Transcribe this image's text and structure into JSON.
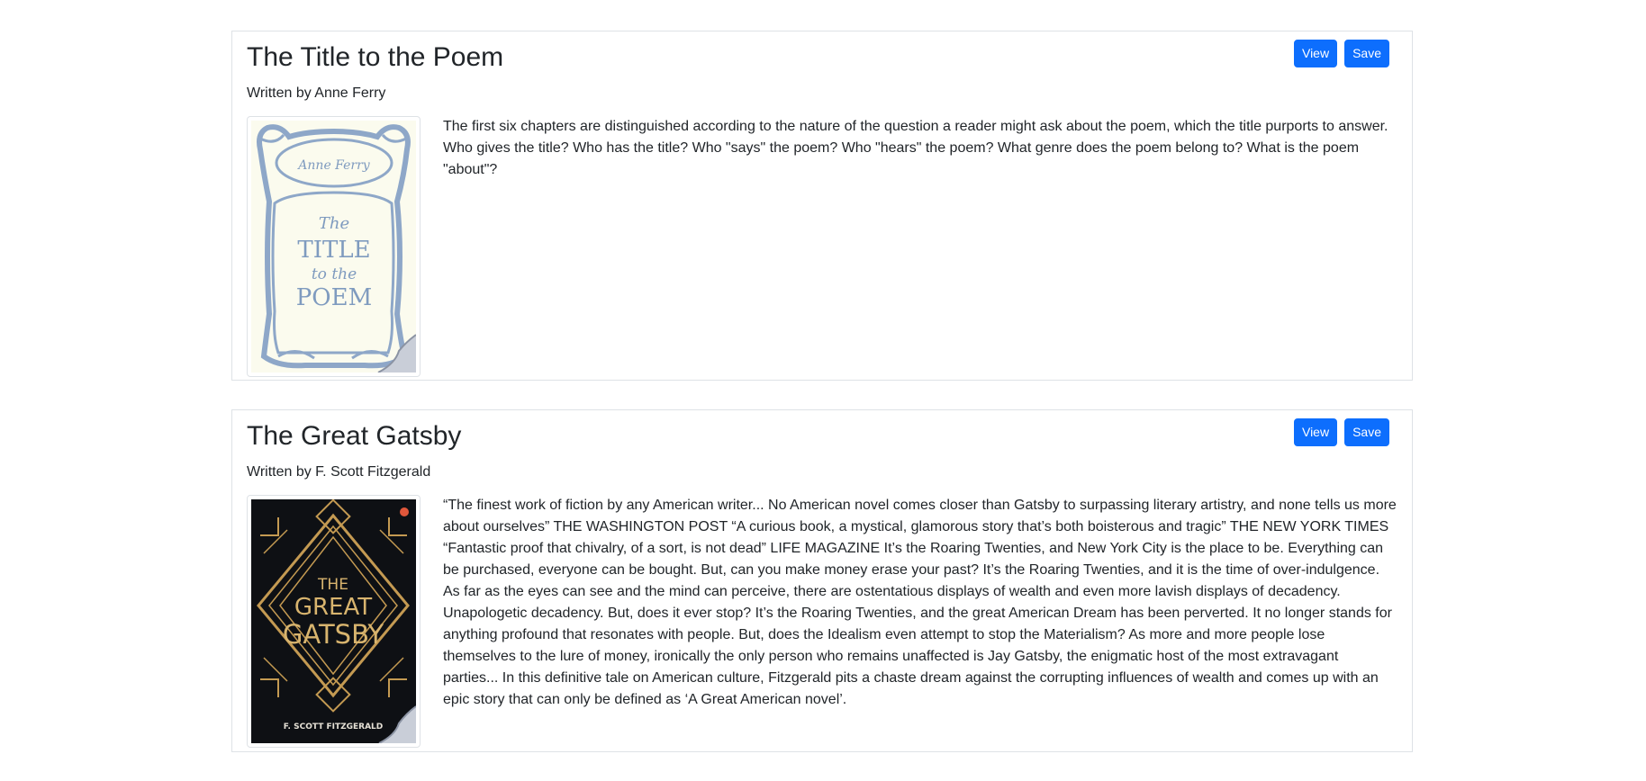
{
  "books": [
    {
      "title": "The Title to the Poem",
      "author_line": "Written by Anne Ferry",
      "view_label": "View",
      "save_label": "Save",
      "cover": {
        "author": "Anne Ferry",
        "line1": "The",
        "line2": "TITLE",
        "line3": "to the",
        "line4": "POEM"
      },
      "description": "The first six chapters are distinguished according to the nature of the question a reader might ask about the poem, which the title purports to answer. Who gives the title? Who has the title? Who \"says\" the poem? Who \"hears\" the poem? What genre does the poem belong to? What is the poem \"about\"?"
    },
    {
      "title": "The Great Gatsby",
      "author_line": "Written by F. Scott Fitzgerald",
      "view_label": "View",
      "save_label": "Save",
      "cover": {
        "line1": "THE",
        "line2": "GREAT",
        "line3": "GATSBY",
        "author": "F. SCOTT FITZGERALD"
      },
      "description": "“The finest work of fiction by any American writer... No American novel comes closer than Gatsby to surpassing literary artistry, and none tells us more about ourselves” THE WASHINGTON POST “A curious book, a mystical, glamorous story that’s both boisterous and tragic” THE NEW YORK TIMES “Fantastic proof that chivalry, of a sort, is not dead” LIFE MAGAZINE It’s the Roaring Twenties, and New York City is the place to be. Everything can be purchased, everyone can be bought. But, can you make money erase your past? It’s the Roaring Twenties, and it is the time of over-indulgence. As far as the eyes can see and the mind can perceive, there are ostentatious displays of wealth and even more lavish displays of decadency. Unapologetic decadency. But, does it ever stop? It’s the Roaring Twenties, and the great American Dream has been perverted. It no longer stands for anything profound that resonates with people. But, does the Idealism even attempt to stop the Materialism? As more and more people lose themselves to the lure of money, ironically the only person who remains unaffected is Jay Gatsby, the enigmatic host of the most extravagant parties... In this definitive tale on American culture, Fitzgerald pits a chaste dream against the corrupting influences of wealth and comes up with an epic story that can only be defined as ‘A Great American novel’."
    }
  ],
  "colors": {
    "primary": "#0d6efd",
    "border": "#dee2e6",
    "text": "#212529",
    "poem_cover_bg": "#fbfbee",
    "poem_cover_ink": "#7f9bbf",
    "gatsby_cover_bg": "#0e1014",
    "gatsby_cover_gold": "#c49a52"
  }
}
